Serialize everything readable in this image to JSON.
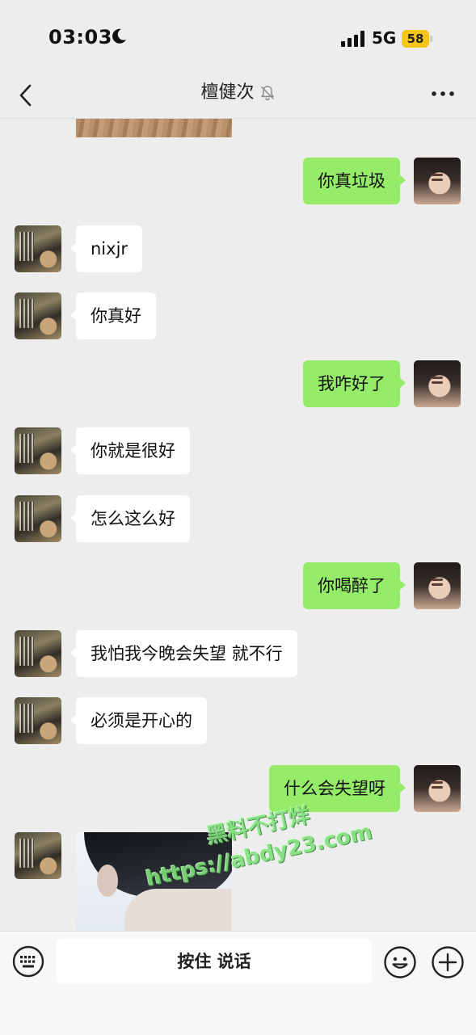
{
  "status_bar": {
    "time": "03:03",
    "network": "5G",
    "battery": "58",
    "icons": [
      "moon-icon",
      "signal-icon",
      "battery-icon"
    ]
  },
  "nav": {
    "title": "檀健次",
    "icons": [
      "back-icon",
      "mute-bell-icon",
      "more-icon"
    ]
  },
  "messages": [
    {
      "side": "out",
      "text": "你真垃圾"
    },
    {
      "side": "in",
      "text": "nixjr"
    },
    {
      "side": "in",
      "text": "你真好"
    },
    {
      "side": "out",
      "text": "我咋好了"
    },
    {
      "side": "in",
      "text": "你就是很好"
    },
    {
      "side": "in",
      "text": "怎么这么好"
    },
    {
      "side": "out",
      "text": "你喝醉了"
    },
    {
      "side": "in",
      "text": "我怕我今晚会失望 就不行"
    },
    {
      "side": "in",
      "text": "必须是开心的"
    },
    {
      "side": "out",
      "text": "什么会失望呀"
    }
  ],
  "watermark": {
    "line1": "黑料不打烊",
    "line2": "https://abdy23.com"
  },
  "input_bar": {
    "hold_to_talk": "按住 说话",
    "icons": [
      "keyboard-icon",
      "emoji-icon",
      "plus-icon"
    ]
  },
  "colors": {
    "background": "#ededed",
    "outgoing_bubble": "#95ec69",
    "incoming_bubble": "#ffffff",
    "battery": "#f5c518",
    "watermark": "#7fe07a"
  }
}
